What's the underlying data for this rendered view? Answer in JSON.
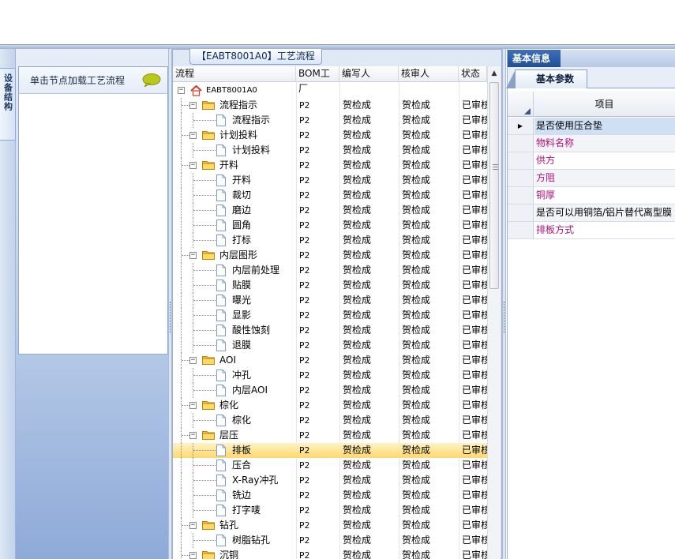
{
  "left_panel": {
    "vertical_tab": "设备结构",
    "hint": "单击节点加载工艺流程"
  },
  "center_panel": {
    "title": "【EABT8001A0】工艺流程",
    "columns": [
      "流程",
      "BOM工厂",
      "编写人",
      "核审人",
      "状态"
    ],
    "root": "EABT8001A0",
    "rows": [
      {
        "level": 1,
        "kind": "folder",
        "name": "流程指示",
        "factory": "P2",
        "writer": "贺检成",
        "reviewer": "贺检成",
        "status": "已审核"
      },
      {
        "level": 2,
        "kind": "doc",
        "name": "流程指示",
        "factory": "P2",
        "writer": "贺检成",
        "reviewer": "贺检成",
        "status": "已审核"
      },
      {
        "level": 1,
        "kind": "folder",
        "name": "计划投料",
        "factory": "P2",
        "writer": "贺检成",
        "reviewer": "贺检成",
        "status": "已审核"
      },
      {
        "level": 2,
        "kind": "doc",
        "name": "计划投料",
        "factory": "P2",
        "writer": "贺检成",
        "reviewer": "贺检成",
        "status": "已审核"
      },
      {
        "level": 1,
        "kind": "folder",
        "name": "开料",
        "factory": "P2",
        "writer": "贺检成",
        "reviewer": "贺检成",
        "status": "已审核"
      },
      {
        "level": 2,
        "kind": "doc",
        "name": "开料",
        "factory": "P2",
        "writer": "贺检成",
        "reviewer": "贺检成",
        "status": "已审核"
      },
      {
        "level": 2,
        "kind": "doc",
        "name": "裁切",
        "factory": "P2",
        "writer": "贺检成",
        "reviewer": "贺检成",
        "status": "已审核"
      },
      {
        "level": 2,
        "kind": "doc",
        "name": "磨边",
        "factory": "P2",
        "writer": "贺检成",
        "reviewer": "贺检成",
        "status": "已审核"
      },
      {
        "level": 2,
        "kind": "doc",
        "name": "圆角",
        "factory": "P2",
        "writer": "贺检成",
        "reviewer": "贺检成",
        "status": "已审核"
      },
      {
        "level": 2,
        "kind": "doc",
        "name": "打标",
        "factory": "P2",
        "writer": "贺检成",
        "reviewer": "贺检成",
        "status": "已审核"
      },
      {
        "level": 1,
        "kind": "folder",
        "name": "内层图形",
        "factory": "P2",
        "writer": "贺检成",
        "reviewer": "贺检成",
        "status": "已审核"
      },
      {
        "level": 2,
        "kind": "doc",
        "name": "内层前处理",
        "factory": "P2",
        "writer": "贺检成",
        "reviewer": "贺检成",
        "status": "已审核"
      },
      {
        "level": 2,
        "kind": "doc",
        "name": "贴膜",
        "factory": "P2",
        "writer": "贺检成",
        "reviewer": "贺检成",
        "status": "已审核"
      },
      {
        "level": 2,
        "kind": "doc",
        "name": "曝光",
        "factory": "P2",
        "writer": "贺检成",
        "reviewer": "贺检成",
        "status": "已审核"
      },
      {
        "level": 2,
        "kind": "doc",
        "name": "显影",
        "factory": "P2",
        "writer": "贺检成",
        "reviewer": "贺检成",
        "status": "已审核"
      },
      {
        "level": 2,
        "kind": "doc",
        "name": "酸性蚀刻",
        "factory": "P2",
        "writer": "贺检成",
        "reviewer": "贺检成",
        "status": "已审核"
      },
      {
        "level": 2,
        "kind": "doc",
        "name": "退膜",
        "factory": "P2",
        "writer": "贺检成",
        "reviewer": "贺检成",
        "status": "已审核"
      },
      {
        "level": 1,
        "kind": "folder",
        "name": "AOI",
        "factory": "P2",
        "writer": "贺检成",
        "reviewer": "贺检成",
        "status": "已审核"
      },
      {
        "level": 2,
        "kind": "doc",
        "name": "冲孔",
        "factory": "P2",
        "writer": "贺检成",
        "reviewer": "贺检成",
        "status": "已审核"
      },
      {
        "level": 2,
        "kind": "doc",
        "name": "内层AOI",
        "factory": "P2",
        "writer": "贺检成",
        "reviewer": "贺检成",
        "status": "已审核"
      },
      {
        "level": 1,
        "kind": "folder",
        "name": "棕化",
        "factory": "P2",
        "writer": "贺检成",
        "reviewer": "贺检成",
        "status": "已审核"
      },
      {
        "level": 2,
        "kind": "doc",
        "name": "棕化",
        "factory": "P2",
        "writer": "贺检成",
        "reviewer": "贺检成",
        "status": "已审核"
      },
      {
        "level": 1,
        "kind": "folder",
        "name": "层压",
        "factory": "P2",
        "writer": "贺检成",
        "reviewer": "贺检成",
        "status": "已审核"
      },
      {
        "level": 2,
        "kind": "doc",
        "name": "排板",
        "factory": "P2",
        "writer": "贺检成",
        "reviewer": "贺检成",
        "status": "已审核",
        "selected": true
      },
      {
        "level": 2,
        "kind": "doc",
        "name": "压合",
        "factory": "P2",
        "writer": "贺检成",
        "reviewer": "贺检成",
        "status": "已审核"
      },
      {
        "level": 2,
        "kind": "doc",
        "name": "X-Ray冲孔",
        "factory": "P2",
        "writer": "贺检成",
        "reviewer": "贺检成",
        "status": "已审核"
      },
      {
        "level": 2,
        "kind": "doc",
        "name": "铣边",
        "factory": "P2",
        "writer": "贺检成",
        "reviewer": "贺检成",
        "status": "已审核"
      },
      {
        "level": 2,
        "kind": "doc",
        "name": "打字唛",
        "factory": "P2",
        "writer": "贺检成",
        "reviewer": "贺检成",
        "status": "已审核"
      },
      {
        "level": 1,
        "kind": "folder",
        "name": "钻孔",
        "factory": "P2",
        "writer": "贺检成",
        "reviewer": "贺检成",
        "status": "已审核"
      },
      {
        "level": 2,
        "kind": "doc",
        "name": "树脂钻孔",
        "factory": "P2",
        "writer": "贺检成",
        "reviewer": "贺检成",
        "status": "已审核"
      },
      {
        "level": 1,
        "kind": "folder",
        "name": "沉铜",
        "factory": "P2",
        "writer": "贺检成",
        "reviewer": "贺检成",
        "status": "已审核"
      }
    ]
  },
  "right_panel": {
    "title": "基本信息",
    "subtab": "基本参数",
    "column_header": "项目",
    "items": [
      {
        "label": "是否使用压合垫",
        "color": "#000000"
      },
      {
        "label": "物料名称",
        "color": "#b0127a"
      },
      {
        "label": "供方",
        "color": "#b0127a"
      },
      {
        "label": "方阻",
        "color": "#b0127a"
      },
      {
        "label": "铜厚",
        "color": "#b0127a"
      },
      {
        "label": "是否可以用铜箔/铝片替代离型膜",
        "color": "#000000"
      },
      {
        "label": "排板方式",
        "color": "#b0127a"
      }
    ]
  },
  "colors": {
    "accent": "#1f4f98",
    "selected_row": "#ffd86e",
    "magenta_label": "#b0127a"
  }
}
